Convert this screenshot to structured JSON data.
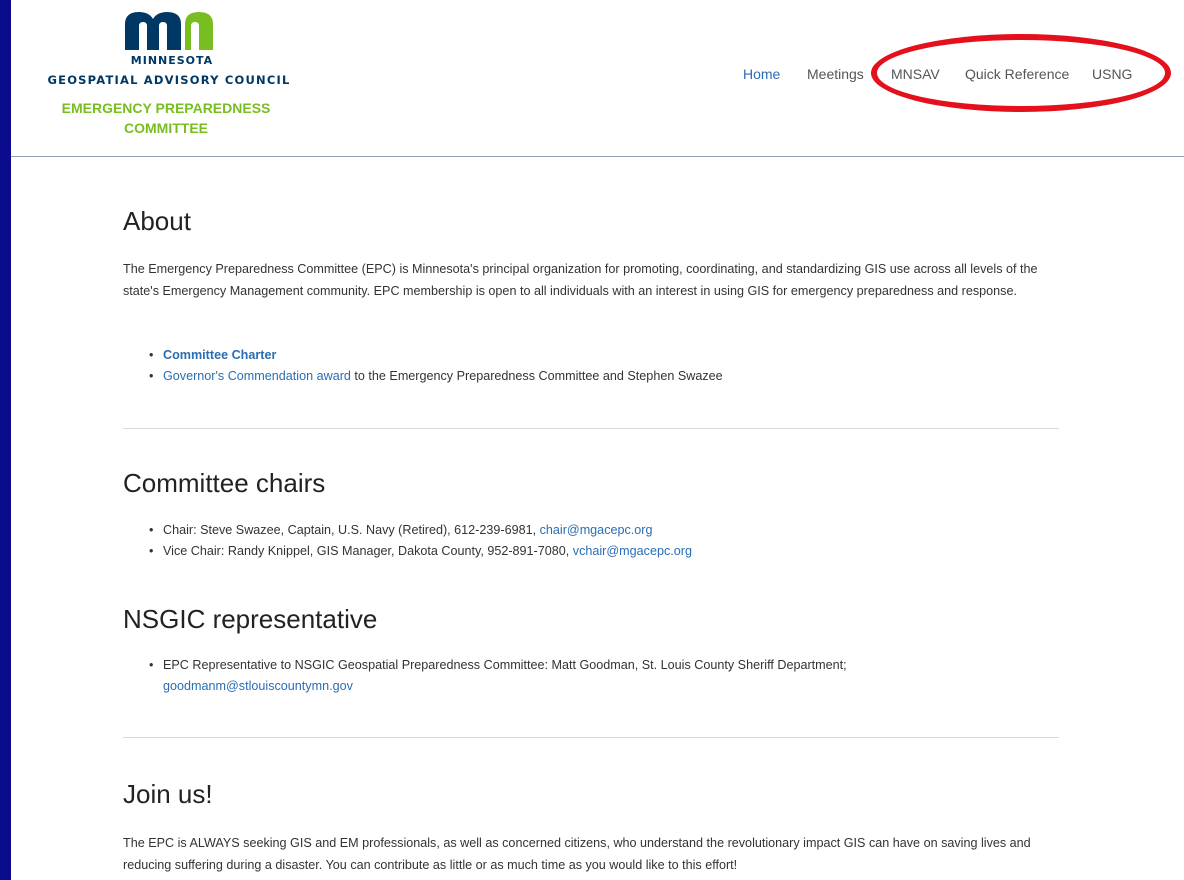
{
  "logo": {
    "state": "MINNESOTA",
    "council": "GEOSPATIAL ADVISORY COUNCIL",
    "committee_line1": "EMERGENCY PREPAREDNESS",
    "committee_line2": "COMMITTEE"
  },
  "nav": [
    {
      "label": "Home"
    },
    {
      "label": "Meetings"
    },
    {
      "label": "MNSAV"
    },
    {
      "label": "Quick Reference"
    },
    {
      "label": "USNG"
    }
  ],
  "colors": {
    "background": "#0a0a8c",
    "highlight": "#e4101c",
    "link": "#2a6db4",
    "brand_navy": "#003865",
    "brand_green": "#78be20"
  },
  "about": {
    "heading": "About",
    "text": "The Emergency Preparedness Committee (EPC) is Minnesota's principal organization for promoting, coordinating, and standardizing GIS use across all levels of the state's Emergency Management community. EPC membership is open to all individuals with an interest in using GIS for emergency preparedness and response.",
    "charter_link": "Committee Charter",
    "award_link": "Governor's Commendation award",
    "award_suffix": " to the Emergency Preparedness Committee and Stephen Swazee"
  },
  "chairs": {
    "heading": "Committee chairs",
    "chair_text": "Chair: Steve Swazee, Captain, U.S. Navy (Retired), 612-239-6981, ",
    "chair_email": "chair@mgacepc.org",
    "vice_text": "Vice Chair: Randy Knippel, GIS Manager, Dakota County, 952-891-7080, ",
    "vice_email": "vchair@mgacepc.org"
  },
  "nsgic": {
    "heading": "NSGIC representative",
    "text": "EPC Representative to NSGIC Geospatial Preparedness Committee: Matt Goodman, St. Louis County Sheriff Department;",
    "email": "goodmanm@stlouiscountymn.gov"
  },
  "join": {
    "heading": "Join us!",
    "text": "The EPC is ALWAYS seeking GIS and EM professionals, as well as concerned citizens, who understand the revolutionary impact GIS can have on saving lives and reducing suffering during a disaster. You can contribute as little or as much time as you would like to this effort!"
  }
}
